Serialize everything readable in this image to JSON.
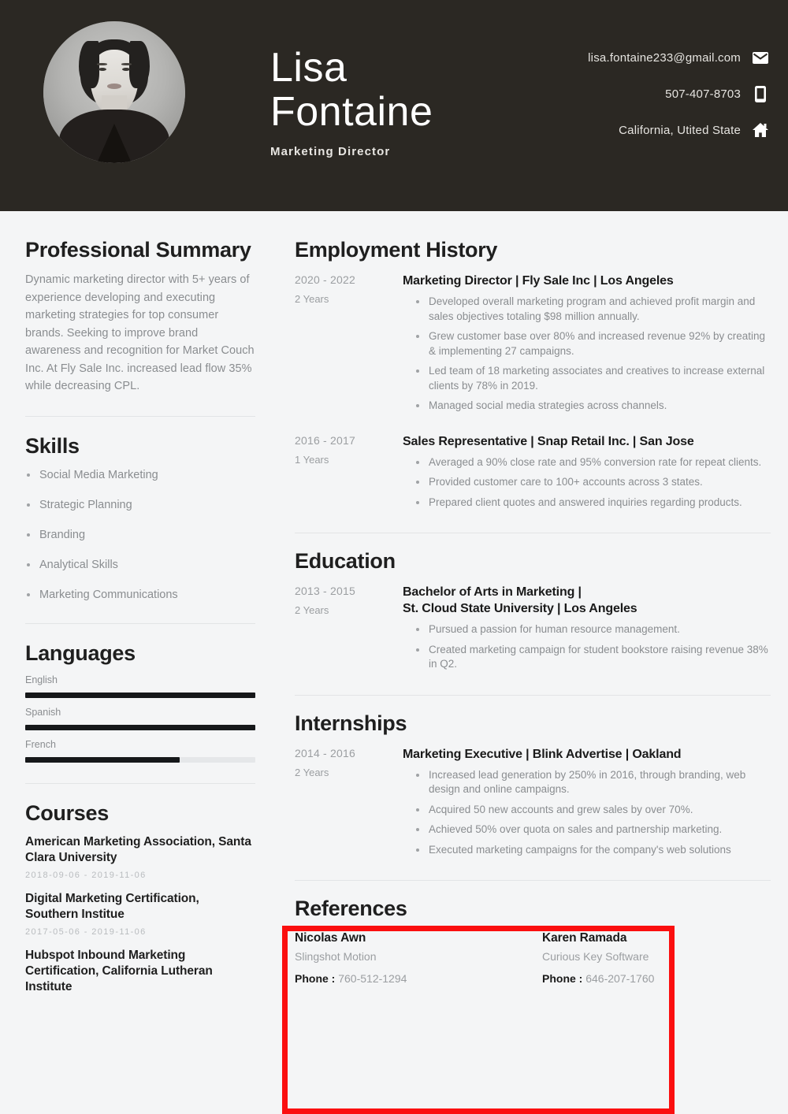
{
  "header": {
    "name_line1": "Lisa",
    "name_line2": "Fontaine",
    "job_title": "Marketing Director",
    "avatar_alt": "portrait-photo",
    "contacts": [
      {
        "text": "lisa.fontaine233@gmail.com",
        "icon": "envelope-icon"
      },
      {
        "text": "507-407-8703",
        "icon": "mobile-phone-icon"
      },
      {
        "text": "California, Utited State",
        "icon": "home-icon"
      }
    ],
    "background_color": "#2b2823",
    "text_color": "#ffffff"
  },
  "left_column": {
    "summary": {
      "heading": "Professional Summary",
      "body": "Dynamic marketing director with 5+ years of experience developing and executing marketing strategies for top consumer brands. Seeking to improve brand awareness and recognition for Market Couch Inc. At Fly Sale Inc. increased lead flow 35% while decreasing CPL."
    },
    "skills": {
      "heading": "Skills",
      "items": [
        "Social Media Marketing",
        "Strategic Planning",
        "Branding",
        "Analytical Skills",
        "Marketing Communications"
      ]
    },
    "languages": {
      "heading": "Languages",
      "items": [
        {
          "name": "English",
          "level_percent": 100
        },
        {
          "name": "Spanish",
          "level_percent": 100
        },
        {
          "name": "French",
          "level_percent": 67
        }
      ]
    },
    "courses": {
      "heading": "Courses",
      "items": [
        {
          "name": "American Marketing Association, Santa Clara University",
          "date_range": "2018-09-06  -  2019-11-06"
        },
        {
          "name": "Digital Marketing Certification, Southern Institue",
          "date_range": "2017-05-06  -  2019-11-06"
        },
        {
          "name": "Hubspot Inbound Marketing Certification, California Lutheran Institute",
          "date_range": ""
        }
      ]
    }
  },
  "right_column": {
    "employment": {
      "heading": "Employment History",
      "entries": [
        {
          "date_range": "2020 - 2022",
          "duration": "2 Years",
          "title": "Marketing Director | Fly Sale Inc | Los Angeles",
          "bullets": [
            "Developed overall marketing program and achieved profit margin and sales objectives totaling $98 million annually.",
            "Grew customer base over 80% and increased revenue 92% by creating & implementing 27 campaigns.",
            "Led team of 18 marketing associates and creatives to increase external clients by 78% in 2019.",
            "Managed social media strategies across channels."
          ]
        },
        {
          "date_range": "2016 - 2017",
          "duration": "1 Years",
          "title": "Sales Representative | Snap Retail Inc. | San Jose",
          "bullets": [
            "Averaged a 90% close rate and 95% conversion rate for repeat clients.",
            "Provided customer care to 100+ accounts across 3 states.",
            "Prepared client quotes and answered inquiries regarding products."
          ]
        }
      ]
    },
    "education": {
      "heading": "Education",
      "entries": [
        {
          "date_range": "2013 - 2015",
          "duration": "2 Years",
          "title": "Bachelor of Arts in Marketing |\nSt. Cloud State University | Los Angeles",
          "bullets": [
            "Pursued a passion for human resource management.",
            "Created marketing campaign for student bookstore raising revenue 38% in Q2."
          ]
        }
      ]
    },
    "internships": {
      "heading": "Internships",
      "entries": [
        {
          "date_range": "2014 - 2016",
          "duration": "2 Years",
          "title": "Marketing Executive | Blink Advertise | Oakland",
          "bullets": [
            "Increased lead generation by 250% in 2016, through branding, web design and online campaigns.",
            "Acquired 50 new accounts and grew sales by over 70%.",
            "Achieved 50% over quota on sales and partnership marketing.",
            "Executed marketing campaigns for the company's web solutions"
          ]
        }
      ]
    },
    "references": {
      "heading": "References",
      "phone_label": "Phone :",
      "items": [
        {
          "name": "Nicolas Awn",
          "company": "Slingshot Motion",
          "phone": "760-512-1294"
        },
        {
          "name": "Karen Ramada",
          "company": "Curious Key Software",
          "phone": "646-207-1760"
        }
      ]
    }
  },
  "annotation": {
    "name": "references-highlight-box",
    "color": "#fb0f0f"
  }
}
